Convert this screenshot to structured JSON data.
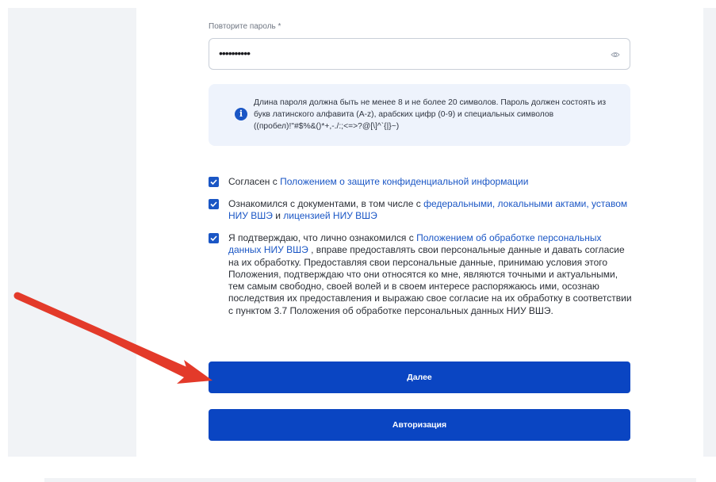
{
  "form": {
    "repeat_password_label": "Повторите пароль *",
    "repeat_password_value": "••••••••••",
    "password_hint": "Длина пароля должна быть не менее 8 и не более 20 символов. Пароль должен состоять из букв латинского алфавита (A-z), арабских цифр (0-9) и специальных символов ((пробел)!\"#$%&()*+,-./:;<=>?@[\\]^`{|}~)",
    "hint_icon": "i"
  },
  "checkboxes": [
    {
      "checked": true,
      "text_before": "Согласен с ",
      "link": "Положением о защите конфиденциальной информации"
    },
    {
      "checked": true,
      "text_before": "Ознакомился с документами, в том числе с ",
      "link1": "федеральными,",
      "link2": "локальными актами,",
      "link3": "уставом НИУ ВШЭ",
      "text_and": " и ",
      "link4": "лицензией НИУ ВШЭ"
    },
    {
      "checked": true,
      "text_before": "Я подтверждаю, что лично ознакомился с ",
      "link": "Положением об обработке персональных данных НИУ ВШЭ",
      "text_after": " , вправе предоставлять свои персональные данные и давать согласие на их обработку. Предоставляя свои персональные данные, принимаю условия этого Положения, подтверждаю что они относятся ко мне, являются точными и актуальными, тем самым свободно, своей волей и в своем интересе распоряжаюсь ими, осознаю последствия их предоставления и выражаю свое согласие на их обработку в соответствии с пунктом 3.7 Положения об обработке персональных данных НИУ ВШЭ."
    }
  ],
  "buttons": {
    "next": "Далее",
    "auth": "Авторизация"
  },
  "colors": {
    "accent": "#0a45c2",
    "link": "#1a56c5",
    "annotation_arrow": "#e33a2a"
  }
}
